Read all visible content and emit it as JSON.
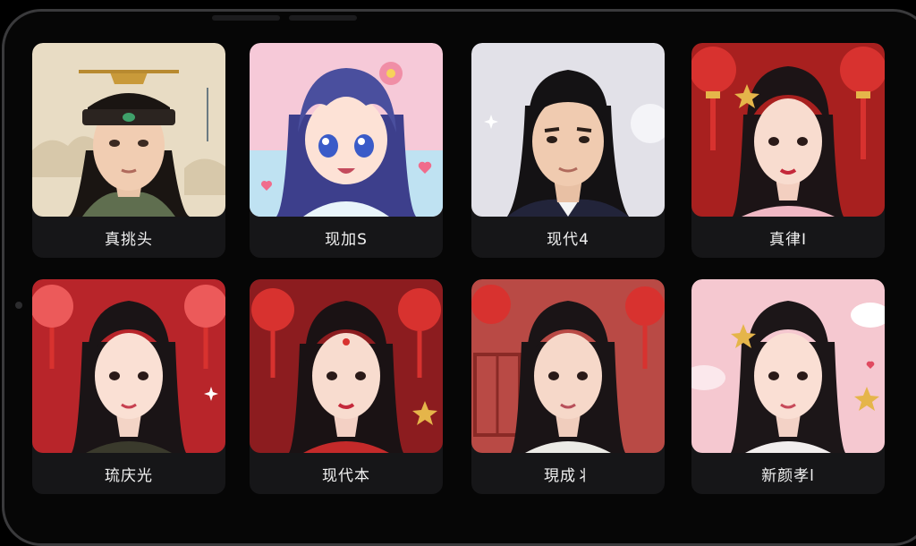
{
  "gallery": {
    "items": [
      {
        "label": "真挑头",
        "style": "ancient-scholar"
      },
      {
        "label": "现加S",
        "style": "anime-girl"
      },
      {
        "label": "现代4",
        "style": "modern-man"
      },
      {
        "label": "真律I",
        "style": "festive-lady"
      },
      {
        "label": "琉庆光",
        "style": "festive-lanterns"
      },
      {
        "label": "现代本",
        "style": "festive-forehead-mark"
      },
      {
        "label": "現成丬",
        "style": "festive-window"
      },
      {
        "label": "新颜孝l",
        "style": "pink-cloud"
      }
    ]
  },
  "colors": {
    "card_bg": "#161618",
    "caption_text": "#f2f2f2",
    "festive_red": "#b8252a",
    "lantern_red": "#d8322f",
    "gold": "#e5b54a",
    "pink_bg": "#f5c8d0"
  }
}
